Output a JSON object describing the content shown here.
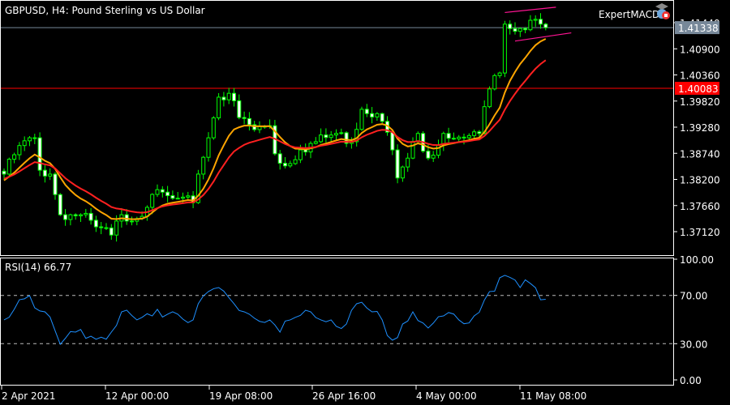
{
  "header": {
    "title": "GBPUSD, H4:  Pound Sterling vs US Dollar",
    "expert_label": "ExpertMACD"
  },
  "colors": {
    "bull": "#00ff00",
    "bear_body": "#ffffff",
    "ma_fast": "#ffa500",
    "ma_slow": "#ff2020",
    "channel": "#ff1493",
    "bid_line": "#778899",
    "level_line": "#ff0000",
    "rsi": "#1e90ff"
  },
  "chart_data": [
    {
      "type": "candlestick",
      "title": "GBPUSD, H4",
      "price_ticks": [
        "1.41440",
        "1.40900",
        "1.40360",
        "1.39820",
        "1.39280",
        "1.38740",
        "1.38200",
        "1.37660",
        "1.37120"
      ],
      "ylim": [
        1.3658,
        1.4191
      ],
      "bid_price": "1.41338",
      "bid_value": 1.41338,
      "level_price": "1.40083",
      "level_value": 1.40083,
      "close_path": [
        [
          0,
          1.3831
        ],
        [
          3,
          1.389
        ],
        [
          6,
          1.3906
        ],
        [
          7,
          1.3839
        ],
        [
          9,
          1.3831
        ],
        [
          11,
          1.3747
        ],
        [
          15,
          1.3747
        ],
        [
          18,
          1.3722
        ],
        [
          21,
          1.3705
        ],
        [
          23,
          1.3747
        ],
        [
          26,
          1.3739
        ],
        [
          29,
          1.3789
        ],
        [
          33,
          1.3781
        ],
        [
          37,
          1.3772
        ],
        [
          38,
          1.3831
        ],
        [
          40,
          1.3906
        ],
        [
          42,
          1.399
        ],
        [
          44,
          1.3998
        ],
        [
          46,
          1.3948
        ],
        [
          49,
          1.3923
        ],
        [
          52,
          1.3931
        ],
        [
          53,
          1.3873
        ],
        [
          55,
          1.3848
        ],
        [
          58,
          1.3881
        ],
        [
          61,
          1.3898
        ],
        [
          65,
          1.3915
        ],
        [
          68,
          1.3898
        ],
        [
          70,
          1.3965
        ],
        [
          73,
          1.3956
        ],
        [
          74,
          1.394
        ],
        [
          76,
          1.3881
        ],
        [
          77,
          1.3823
        ],
        [
          79,
          1.3864
        ],
        [
          81,
          1.3915
        ],
        [
          83,
          1.3864
        ],
        [
          86,
          1.3915
        ],
        [
          90,
          1.3906
        ],
        [
          93,
          1.3915
        ],
        [
          95,
          1.4007
        ],
        [
          97,
          1.404
        ],
        [
          98,
          1.4141
        ],
        [
          101,
          1.4132
        ],
        [
          103,
          1.4149
        ],
        [
          105,
          1.4141
        ],
        [
          106,
          1.41338
        ]
      ],
      "channel": {
        "upper": [
          [
            98,
            1.4165
          ],
          [
            108,
            1.4176
          ]
        ],
        "lower": [
          [
            100,
            1.4106
          ],
          [
            111,
            1.4123
          ]
        ]
      },
      "x_ticks": [
        "2 Apr 2021",
        "12 Apr 00:00",
        "19 Apr 08:00",
        "26 Apr 16:00",
        "4 May 00:00",
        "11 May 08:00"
      ]
    },
    {
      "type": "line",
      "title": "RSI(14) 66.77",
      "ylim": [
        0,
        100
      ],
      "ticks": [
        "100.00",
        "70.00",
        "30.00",
        "0.00"
      ],
      "levels": [
        70,
        30
      ],
      "rsi_path": [
        [
          0,
          49.7
        ],
        [
          3,
          66.4
        ],
        [
          5,
          69.8
        ],
        [
          6,
          59.7
        ],
        [
          8,
          56.4
        ],
        [
          11,
          29.5
        ],
        [
          14,
          39.6
        ],
        [
          17,
          36.2
        ],
        [
          21,
          39.6
        ],
        [
          23,
          56.4
        ],
        [
          26,
          49.7
        ],
        [
          29,
          53.0
        ],
        [
          33,
          56.4
        ],
        [
          37,
          49.7
        ],
        [
          38,
          63.1
        ],
        [
          40,
          73.2
        ],
        [
          42,
          76.5
        ],
        [
          45,
          63.1
        ],
        [
          47,
          56.4
        ],
        [
          52,
          49.7
        ],
        [
          54,
          39.6
        ],
        [
          56,
          49.7
        ],
        [
          60,
          56.4
        ],
        [
          64,
          49.7
        ],
        [
          67,
          46.3
        ],
        [
          69,
          63.1
        ],
        [
          72,
          56.4
        ],
        [
          74,
          49.7
        ],
        [
          76,
          32.9
        ],
        [
          78,
          46.3
        ],
        [
          80,
          56.4
        ],
        [
          83,
          43.0
        ],
        [
          86,
          53.0
        ],
        [
          89,
          49.7
        ],
        [
          92,
          53.0
        ],
        [
          95,
          73.2
        ],
        [
          98,
          86.6
        ],
        [
          101,
          76.5
        ],
        [
          103,
          79.9
        ],
        [
          105,
          66.4
        ],
        [
          106,
          66.77
        ]
      ]
    }
  ]
}
